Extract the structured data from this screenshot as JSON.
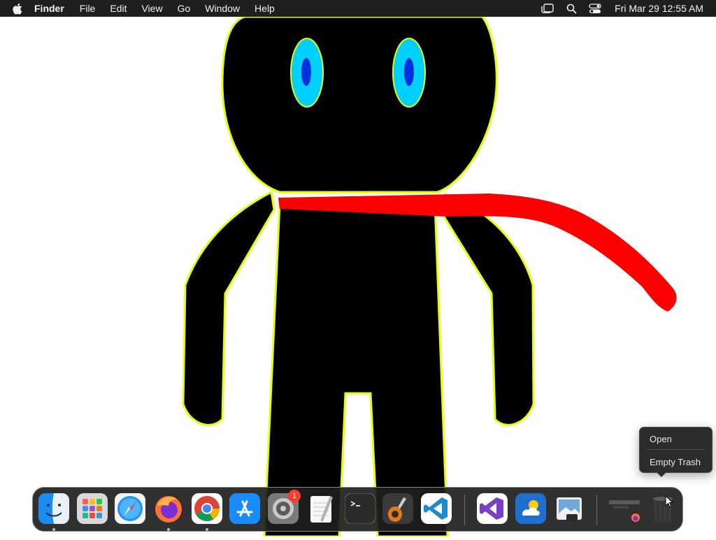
{
  "menubar": {
    "app_name": "Finder",
    "items": [
      "File",
      "Edit",
      "View",
      "Go",
      "Window",
      "Help"
    ],
    "status_icons": [
      "stage-manager-icon",
      "spotlight-search-icon",
      "control-center-icon"
    ],
    "clock": "Fri Mar 29  12:55 AM"
  },
  "desktop": {
    "wallpaper": "stick-figure-drawing",
    "colors": {
      "figure": "#000000",
      "outline": "#e6ff00",
      "eyes": "#00d0ff",
      "pupils": "#0030e0",
      "scarf": "#ff0000"
    }
  },
  "context_menu": {
    "target": "Trash",
    "items": [
      "Open",
      "Empty Trash"
    ]
  },
  "dock": {
    "apps": [
      {
        "name": "Finder",
        "icon": "finder-icon",
        "running": true
      },
      {
        "name": "Launchpad",
        "icon": "launchpad-icon",
        "running": false
      },
      {
        "name": "Safari",
        "icon": "safari-icon",
        "running": false
      },
      {
        "name": "Firefox",
        "icon": "firefox-icon",
        "running": true
      },
      {
        "name": "Google Chrome",
        "icon": "chrome-icon",
        "running": true
      },
      {
        "name": "App Store",
        "icon": "app-store-icon",
        "running": false
      },
      {
        "name": "System Settings",
        "icon": "settings-icon",
        "running": false,
        "badge": "1"
      },
      {
        "name": "TextEdit",
        "icon": "textedit-icon",
        "running": false
      },
      {
        "name": "Terminal",
        "icon": "terminal-icon",
        "running": false
      },
      {
        "name": "GarageBand",
        "icon": "garageband-icon",
        "running": false
      },
      {
        "name": "Visual Studio Code",
        "icon": "vscode-icon",
        "running": false
      }
    ],
    "recent_apps": [
      {
        "name": "Visual Studio",
        "icon": "visual-studio-icon"
      },
      {
        "name": "Weather",
        "icon": "weather-icon"
      },
      {
        "name": "Preview",
        "icon": "preview-icon"
      }
    ],
    "stack": {
      "name": "Downloads",
      "icon": "downloads-stack-icon"
    },
    "trash": {
      "name": "Trash",
      "icon": "trash-icon"
    }
  }
}
